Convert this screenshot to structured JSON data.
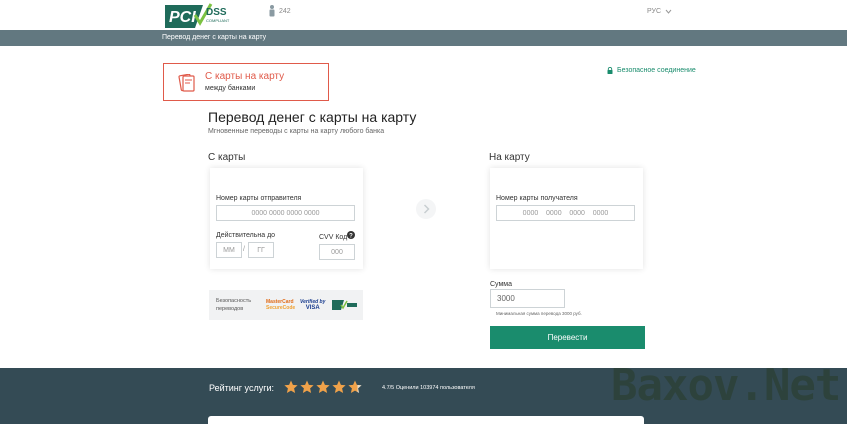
{
  "header": {
    "online_count": "242",
    "language": "РУС",
    "logo_text": "PCI DSS COMPLIANT"
  },
  "breadcrumb": "Перевод денег с карты на карту",
  "transfer_type": {
    "title": "С карты на карту",
    "subtitle": "между банками"
  },
  "secure_label": "Безопасное соединение",
  "page_title": "Перевод денег с карты на карту",
  "page_subtitle": "Мгновенные переводы с карты на карту любого банка",
  "from_card": {
    "section_label": "С карты",
    "number_label": "Номер карты отправителя",
    "number_placeholder": "0000 0000 0000 0000",
    "expiry_label": "Действительна до",
    "month_placeholder": "ММ",
    "separator": "/",
    "year_placeholder": "ГГ",
    "cvv_label": "CVV Код",
    "cvv_placeholder": "000"
  },
  "to_card": {
    "section_label": "На карту",
    "number_label": "Номер карты получателя",
    "number_placeholder": "0000    0000    0000    0000"
  },
  "security": {
    "label": "Безопасность переводов",
    "mastercard_line1": "MasterCard",
    "mastercard_line2": "SecureCode",
    "visa_line1": "Verified by",
    "visa_line2": "VISA"
  },
  "amount": {
    "label": "Сумма",
    "value": "3000",
    "min_note": "Минимальная сумма перевода 3000 руб."
  },
  "transfer_button": "Перевести",
  "rating": {
    "label": "Рейтинг услуги:",
    "stars": 5,
    "text": "4.7/5 Оценили 103974 пользователя"
  },
  "watermark": "Baxov.Net",
  "colors": {
    "accent": "#1a8c6d",
    "alert": "#e05a4a",
    "bar": "#627880",
    "footer": "#344b55",
    "star": "#f0a24a"
  }
}
